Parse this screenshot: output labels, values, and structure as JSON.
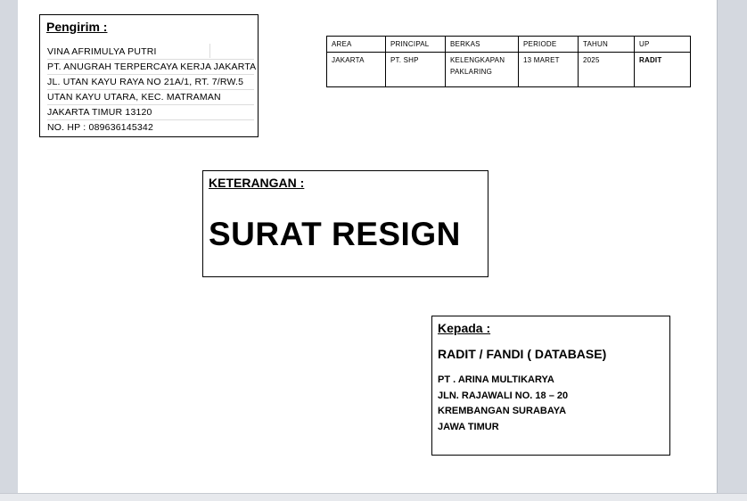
{
  "sender": {
    "heading": "Pengirim :",
    "lines": [
      "VINA AFRIMULYA PUTRI",
      "PT. ANUGRAH TERPERCAYA KERJA JAKARTA",
      "JL. UTAN KAYU RAYA NO 21A/1, RT. 7/RW.5",
      "UTAN KAYU UTARA, KEC. MATRAMAN",
      "JAKARTA TIMUR 13120",
      "NO. HP : 089636145342"
    ]
  },
  "info_table": {
    "headers": [
      "AREA",
      "PRINCIPAL",
      "BERKAS",
      "PERIODE",
      "TAHUN",
      "UP"
    ],
    "values": [
      "JAKARTA",
      "PT. SHP",
      "KELENGKAPAN PAKLARING",
      "13 MARET",
      "2025",
      "RADIT"
    ]
  },
  "keterangan": {
    "heading": "KETERANGAN :",
    "title": "SURAT RESIGN"
  },
  "recipient": {
    "heading": "Kepada :",
    "name": "RADIT / FANDI ( DATABASE)",
    "lines": [
      "PT . ARINA MULTIKARYA",
      "JLN. RAJAWALI NO. 18 – 20",
      "KREMBANGAN SURABAYA",
      "JAWA TIMUR"
    ]
  }
}
